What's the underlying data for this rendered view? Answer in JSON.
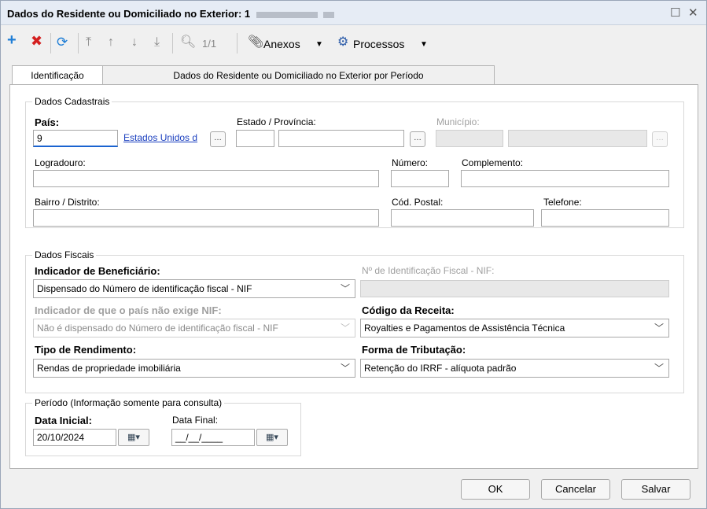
{
  "window": {
    "title": "Dados do Residente ou Domiciliado no Exterior: 1"
  },
  "toolbar": {
    "record_count": "1/1",
    "anexos": "Anexos",
    "processos": "Processos"
  },
  "tabs": [
    {
      "label": "Identificação"
    },
    {
      "label": "Dados do Residente ou Domiciliado no Exterior por Período"
    }
  ],
  "cadastrais": {
    "legend": "Dados Cadastrais",
    "pais_label": "País:",
    "pais_code": "9",
    "pais_name": "Estados Unidos d",
    "estado_label": "Estado / Província:",
    "municipio_label": "Município:",
    "logradouro_label": "Logradouro:",
    "numero_label": "Número:",
    "complemento_label": "Complemento:",
    "bairro_label": "Bairro / Distrito:",
    "cep_label": "Cód. Postal:",
    "telefone_label": "Telefone:"
  },
  "fiscais": {
    "legend": "Dados Fiscais",
    "indicador_label": "Indicador de Beneficiário:",
    "indicador_value": "Dispensado do Número de identificação fiscal - NIF",
    "nif_label": "Nº de Identificação Fiscal - NIF:",
    "pais_nif_label": "Indicador de que o país não exige NIF:",
    "pais_nif_value": "Não é dispensado do Número de identificação fiscal - NIF",
    "codigo_label": "Código da Receita:",
    "codigo_value": "Royalties e Pagamentos de Assistência Técnica",
    "rendimento_label": "Tipo de Rendimento:",
    "rendimento_value": "Rendas de propriedade imobiliária",
    "tributacao_label": "Forma de Tributação:",
    "tributacao_value": "Retenção do IRRF - alíquota padrão"
  },
  "periodo": {
    "legend": "Período (Informação somente para consulta)",
    "inicial_label": "Data Inicial:",
    "inicial_value": "20/10/2024",
    "final_label": "Data Final:",
    "final_value": "__/__/____"
  },
  "footer": {
    "ok": "OK",
    "cancelar": "Cancelar",
    "salvar": "Salvar"
  },
  "colors": {
    "add": "#1f7ed6",
    "delete": "#d42020",
    "link": "#1a3fbf",
    "focus": "#1a63d0"
  }
}
